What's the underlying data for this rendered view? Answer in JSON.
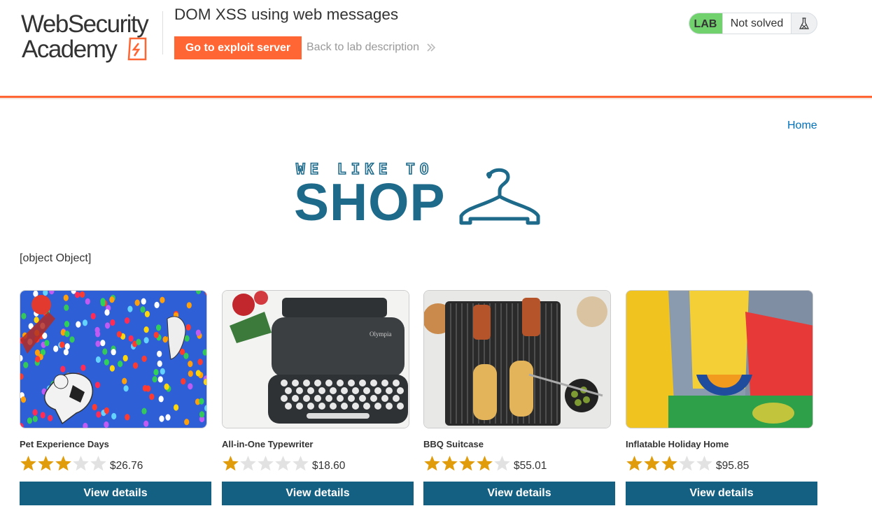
{
  "header": {
    "logo_text_line1": "WebSecurity",
    "logo_text_line2": "Academy",
    "lab_title": "DOM XSS using web messages",
    "exploit_button": "Go to exploit server",
    "back_link": "Back to lab description",
    "lab_badge": "LAB",
    "status": "Not solved",
    "status_icon": "flask-icon",
    "accent_color": "#ff6633",
    "badge_color": "#70d16d"
  },
  "nav": {
    "home": "Home"
  },
  "banner": {
    "line1": "WE LIKE TO",
    "line2": "SHOP",
    "icon": "hanger-icon",
    "color": "#1d6a8b"
  },
  "message": "[object Object]",
  "products": [
    {
      "name": "Pet Experience Days",
      "rating": 3,
      "price": "$26.76",
      "button": "View details"
    },
    {
      "name": "All-in-One Typewriter",
      "rating": 1,
      "price": "$18.60",
      "button": "View details"
    },
    {
      "name": "BBQ Suitcase",
      "rating": 4,
      "price": "$55.01",
      "button": "View details"
    },
    {
      "name": "Inflatable Holiday Home",
      "rating": 3,
      "price": "$95.85",
      "button": "View details"
    }
  ]
}
